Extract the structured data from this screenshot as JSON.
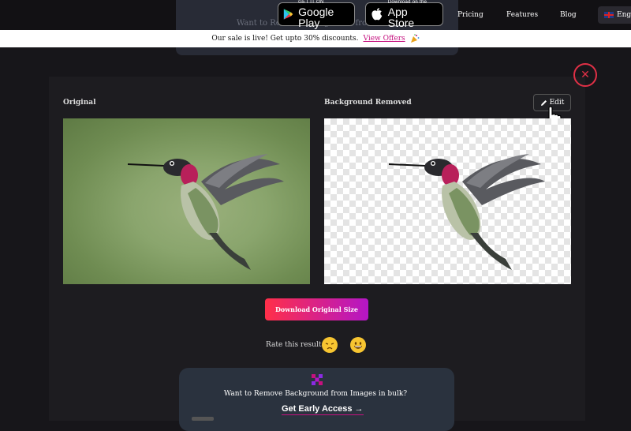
{
  "nav": {
    "ghost_text": "Want to Remove Background from Images in bulk?",
    "google_play": {
      "small": "GET IT ON",
      "big": "Google Play"
    },
    "app_store": {
      "small": "Download on the",
      "big": "App Store"
    },
    "links": [
      "Pricing",
      "Features",
      "Blog"
    ],
    "language": "Engl"
  },
  "promo": {
    "text": "Our sale is live! Get upto 30% discounts.",
    "link": "View Offers",
    "icon": "party-popper-icon"
  },
  "result": {
    "original_label": "Original",
    "removed_label": "Background Removed",
    "edit_label": "Edit",
    "download_label": "Download Original Size",
    "rate_label": "Rate this result:",
    "emojis": [
      "sad-face-icon",
      "happy-face-icon"
    ]
  },
  "bulk": {
    "text": "Want to Remove Background from Images in bulk?",
    "cta": "Get Early Access →"
  },
  "colors": {
    "accent": "#c5117f",
    "close": "#e03046",
    "gradient_start": "#ff2f49",
    "gradient_end": "#b416c6"
  }
}
